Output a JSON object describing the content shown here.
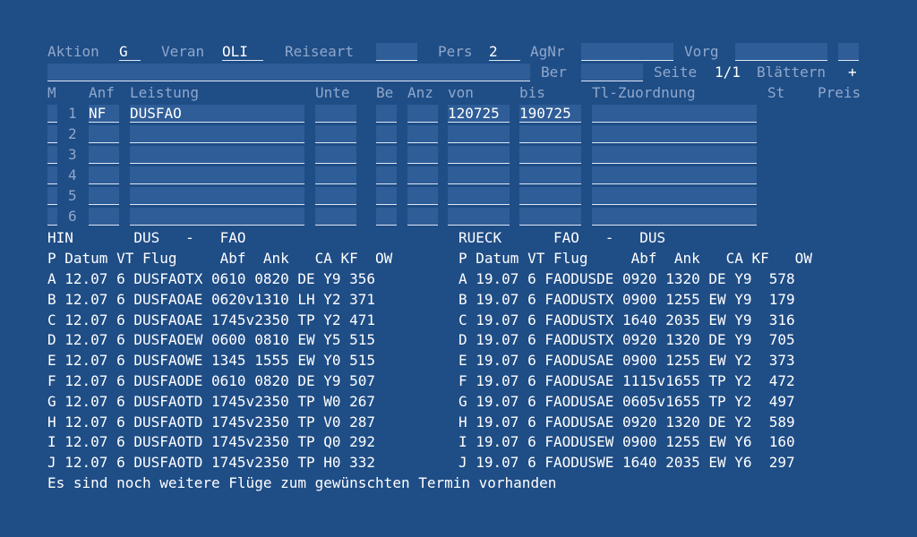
{
  "header": {
    "aktion_label": "Aktion",
    "aktion_value": "G",
    "veran_label": "Veran",
    "veran_value": "OLI",
    "reiseart_label": "Reiseart",
    "reiseart_value": "",
    "pers_label": "Pers",
    "pers_value": "2",
    "agnr_label": "AgNr",
    "agnr_value": "",
    "vorg_label": "Vorg",
    "vorg_value": "",
    "vorg_extra_value": "",
    "line2_value": "",
    "ber_label": "Ber",
    "ber_value": "",
    "seite_label": "Seite",
    "seite_value": "1/1",
    "blaettern_label": "Blättern",
    "blaettern_value": "+"
  },
  "grid": {
    "columns": {
      "m": "M",
      "anf": "Anf",
      "leistung": "Leistung",
      "unte": "Unte",
      "be": "Be",
      "anz": "Anz",
      "von": "von",
      "bis": "bis",
      "tl": "Tl-Zuordnung",
      "st": "St",
      "preis": "Preis"
    },
    "rows": [
      {
        "num": "1",
        "anf": "NF",
        "leistung": "DUSFAO",
        "von": "120725",
        "bis": "190725"
      },
      {
        "num": "2",
        "anf": "",
        "leistung": "",
        "von": "",
        "bis": ""
      },
      {
        "num": "3",
        "anf": "",
        "leistung": "",
        "von": "",
        "bis": ""
      },
      {
        "num": "4",
        "anf": "",
        "leistung": "",
        "von": "",
        "bis": ""
      },
      {
        "num": "5",
        "anf": "",
        "leistung": "",
        "von": "",
        "bis": ""
      },
      {
        "num": "6",
        "anf": "",
        "leistung": "",
        "von": "",
        "bis": ""
      }
    ]
  },
  "flights": {
    "hin_title": "HIN       DUS   -   FAO",
    "rueck_title": "RUECK      FAO   -   DUS",
    "hin_header": "P Datum VT Flug     Abf  Ank   CA KF  OW",
    "rueck_header": "P Datum VT Flug     Abf  Ank   CA KF   OW",
    "hin": [
      "A 12.07 6 DUSFAOTX 0610 0820 DE Y9 356",
      "B 12.07 6 DUSFAOAE 0620v1310 LH Y2 371",
      "C 12.07 6 DUSFAOAE 1745v2350 TP Y2 471",
      "D 12.07 6 DUSFAOEW 0600 0810 EW Y5 515",
      "E 12.07 6 DUSFAOWE 1345 1555 EW Y0 515",
      "F 12.07 6 DUSFAODE 0610 0820 DE Y9 507",
      "G 12.07 6 DUSFAOTD 1745v2350 TP W0 267",
      "H 12.07 6 DUSFAOTD 1745v2350 TP V0 287",
      "I 12.07 6 DUSFAOTD 1745v2350 TP Q0 292",
      "J 12.07 6 DUSFAOTD 1745v2350 TP H0 332"
    ],
    "rueck": [
      "A 19.07 6 FAODUSDE 0920 1320 DE Y9  578",
      "B 19.07 6 FAODUSTX 0900 1255 EW Y9  179",
      "C 19.07 6 FAODUSTX 1640 2035 EW Y9  316",
      "D 19.07 6 FAODUSTX 0920 1320 DE Y9  705",
      "E 19.07 6 FAODUSAE 0900 1255 EW Y2  373",
      "F 19.07 6 FAODUSAE 1115v1655 TP Y2  472",
      "G 19.07 6 FAODUSAE 0605v1655 TP Y2  497",
      "H 19.07 6 FAODUSAE 0920 1320 DE Y2  589",
      "I 19.07 6 FAODUSEW 0900 1255 EW Y6  160",
      "J 19.07 6 FAODUSWE 1640 2035 EW Y6  297"
    ],
    "footer": "Es sind noch weitere Flüge zum gewünschten Termin vorhanden"
  }
}
